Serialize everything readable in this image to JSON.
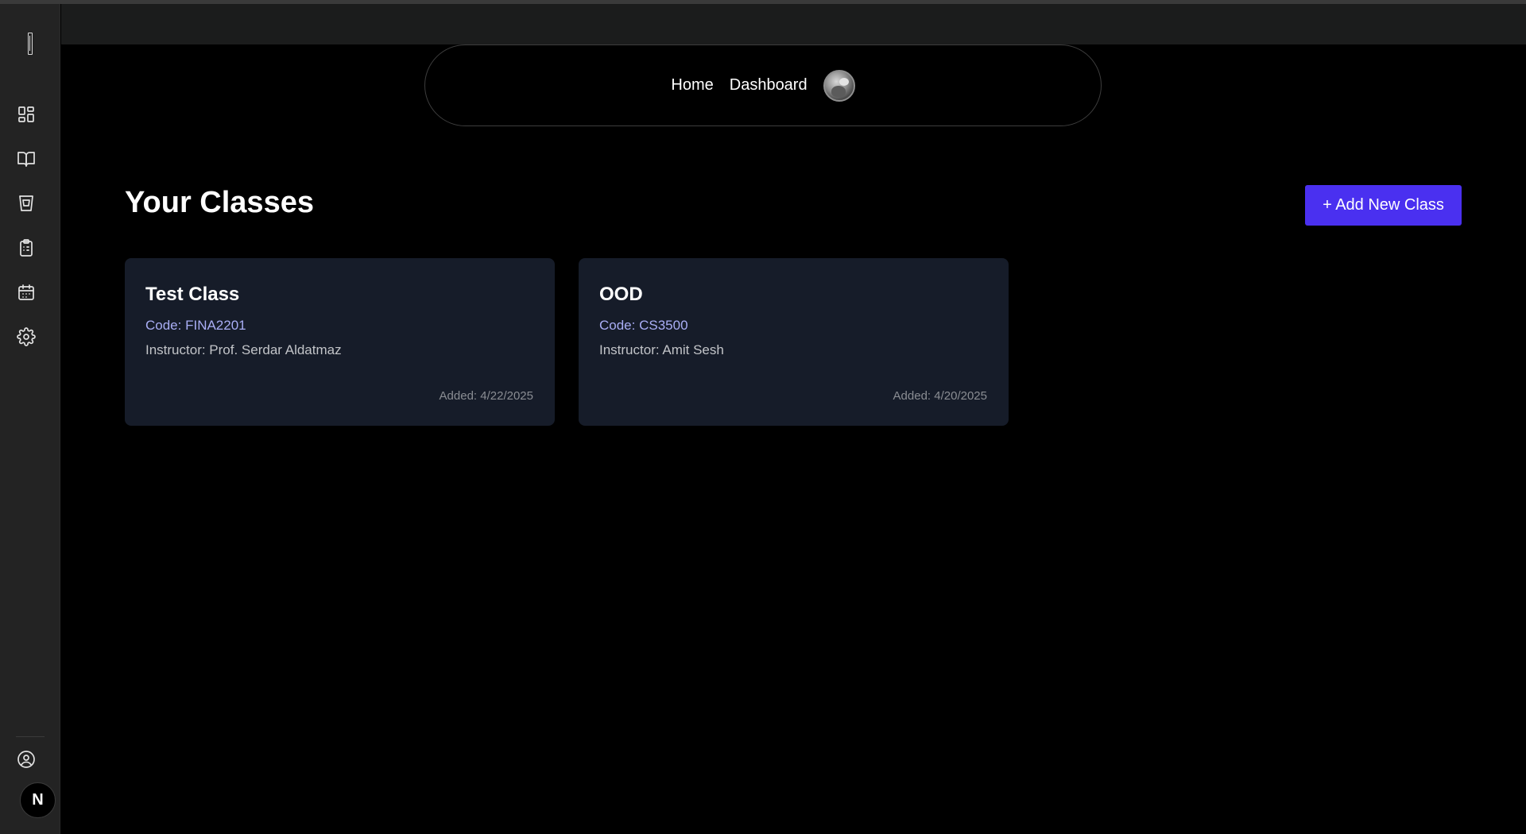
{
  "sidebar": {
    "icons": [
      {
        "name": "dashboard-icon"
      },
      {
        "name": "book-icon"
      },
      {
        "name": "bucket-icon"
      },
      {
        "name": "clipboard-icon"
      },
      {
        "name": "calendar-icon"
      },
      {
        "name": "gear-icon"
      }
    ],
    "profile_icon": "user-circle-icon",
    "badge_letter": "N"
  },
  "nav": {
    "home_label": "Home",
    "dashboard_label": "Dashboard"
  },
  "page": {
    "title": "Your Classes",
    "add_button_label": "+ Add New Class"
  },
  "classes": [
    {
      "name": "Test Class",
      "code": "Code: FINA2201",
      "instructor": "Instructor: Prof. Serdar Aldatmaz",
      "added": "Added: 4/22/2025"
    },
    {
      "name": "OOD",
      "code": "Code: CS3500",
      "instructor": "Instructor: Amit Sesh",
      "added": "Added: 4/20/2025"
    }
  ],
  "colors": {
    "accent": "#4a30f0",
    "card_bg": "#161c29",
    "code_text": "#a9aef5"
  }
}
